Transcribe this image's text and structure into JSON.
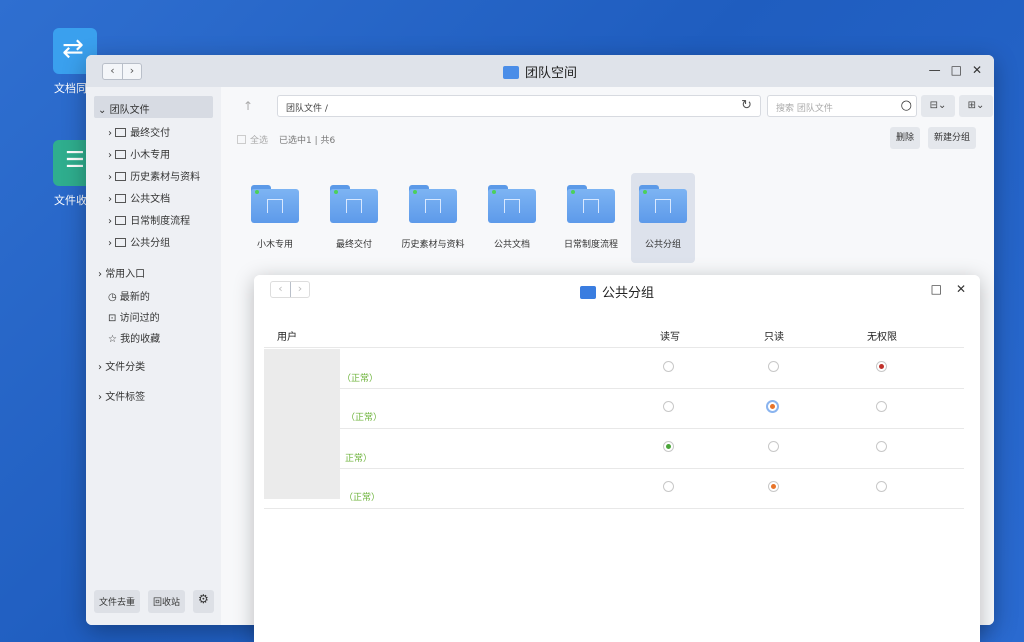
{
  "desktop": {
    "icon1_label": "文档同",
    "icon2_label": "文件收"
  },
  "main_window": {
    "title": "团队空间",
    "path": "团队文件 /",
    "search_placeholder": "搜索 团队文件",
    "select_all": "全选",
    "selection_info": "已选中1 | 共6",
    "delete_label": "删除",
    "new_group_label": "新建分组"
  },
  "sidebar": {
    "team_files": "团队文件",
    "folders": [
      "最终交付",
      "小木专用",
      "历史素材与资料",
      "公共文档",
      "日常制度流程",
      "公共分组"
    ],
    "common_entry": "常用入口",
    "recent": "最新的",
    "visited": "访问过的",
    "favorites": "我的收藏",
    "file_category": "文件分类",
    "file_tags": "文件标签",
    "dedupe": "文件去重",
    "recycle": "回收站"
  },
  "folders": [
    "小木专用",
    "最终交付",
    "历史素材与资料",
    "公共文档",
    "日常制度流程",
    "公共分组"
  ],
  "dialog": {
    "title": "公共分组",
    "col_user": "用户",
    "col_rw": "读写",
    "col_ro": "只读",
    "col_none": "无权限",
    "rows": [
      {
        "status": "（正常）",
        "perm": "none"
      },
      {
        "status": "（正常）",
        "perm": "ro"
      },
      {
        "status": "正常）",
        "perm": "rw"
      },
      {
        "status": "（正常）",
        "perm": "ro"
      }
    ]
  },
  "colors": {
    "accent_blue": "#3a7de0",
    "status_green": "#6cb33a",
    "radio_red": "#c0312b",
    "radio_orange": "#e8742a",
    "radio_green": "#4aa53a"
  }
}
